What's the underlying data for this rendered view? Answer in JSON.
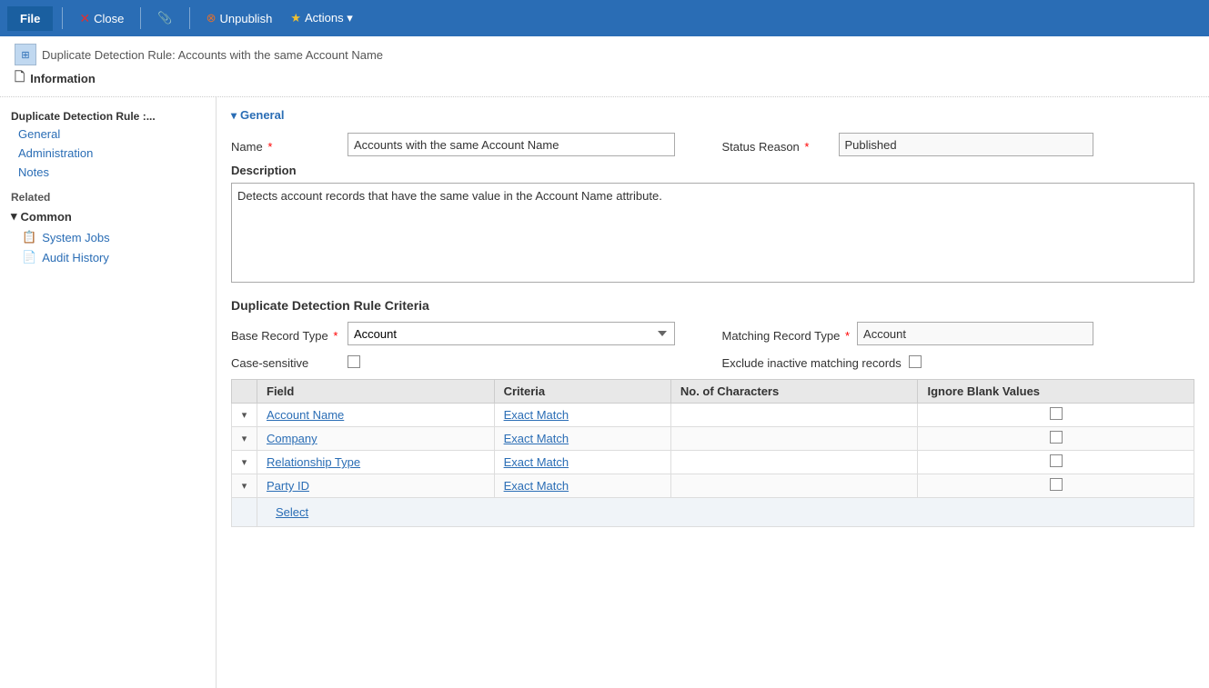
{
  "toolbar": {
    "file_label": "File",
    "close_label": "Close",
    "unpublish_label": "Unpublish",
    "actions_label": "Actions ▾",
    "attachment_icon": "📎"
  },
  "record": {
    "breadcrumb": "Duplicate Detection Rule: Accounts with the same Account Name",
    "title": "Information",
    "title_icon": "🗋"
  },
  "sidebar": {
    "nav_title": "Duplicate Detection Rule :...",
    "nav_items": [
      {
        "label": "General",
        "id": "general"
      },
      {
        "label": "Administration",
        "id": "administration"
      },
      {
        "label": "Notes",
        "id": "notes"
      }
    ],
    "related_title": "Related",
    "common_title": "Common",
    "common_items": [
      {
        "label": "System Jobs",
        "icon": "📋",
        "id": "system-jobs"
      },
      {
        "label": "Audit History",
        "icon": "📄",
        "id": "audit-history"
      }
    ]
  },
  "general": {
    "section_title": "General",
    "name_label": "Name",
    "name_value": "Accounts with the same Account Name",
    "status_reason_label": "Status Reason",
    "status_reason_value": "Published",
    "description_label": "Description",
    "description_value": "Detects account records that have the same value in the Account Name attribute."
  },
  "criteria": {
    "title": "Duplicate Detection Rule Criteria",
    "base_record_type_label": "Base Record Type",
    "base_record_type_value": "Account",
    "matching_record_type_label": "Matching Record Type",
    "matching_record_type_value": "Account",
    "case_sensitive_label": "Case-sensitive",
    "exclude_inactive_label": "Exclude inactive matching records",
    "table": {
      "headers": [
        "",
        "Field",
        "Criteria",
        "No. of Characters",
        "Ignore Blank Values"
      ],
      "rows": [
        {
          "expand": "▾",
          "field": "Account Name",
          "criteria": "Exact Match",
          "num_chars": "",
          "ignore_blank": false
        },
        {
          "expand": "▾",
          "field": "Company",
          "criteria": "Exact Match",
          "num_chars": "",
          "ignore_blank": false
        },
        {
          "expand": "▾",
          "field": "Relationship Type",
          "criteria": "Exact Match",
          "num_chars": "",
          "ignore_blank": false
        },
        {
          "expand": "▾",
          "field": "Party ID",
          "criteria": "Exact Match",
          "num_chars": "",
          "ignore_blank": false
        }
      ],
      "select_label": "Select"
    }
  }
}
